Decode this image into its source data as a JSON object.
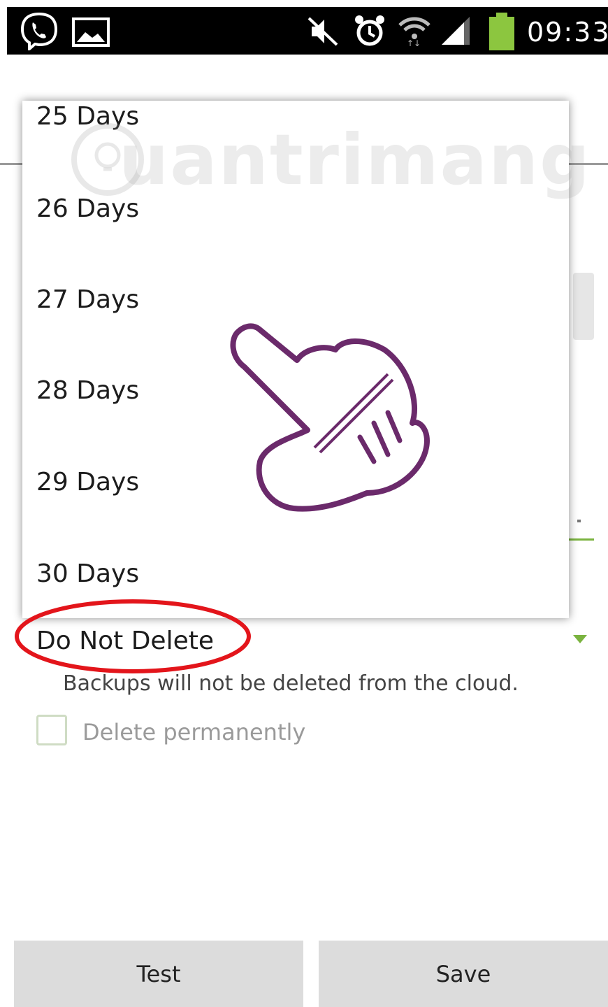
{
  "status_bar": {
    "time": "09:33",
    "icons": [
      "viber-icon",
      "gallery-icon",
      "mute-icon",
      "alarm-icon",
      "wifi-icon",
      "signal-icon",
      "battery-icon"
    ],
    "battery_color": "#8cc63f"
  },
  "popup": {
    "options": [
      "25 Days",
      "26 Days",
      "27 Days",
      "28 Days",
      "29 Days",
      "30 Days"
    ]
  },
  "watermark": "uantrimang",
  "setting": {
    "selected_value": "Do Not Delete",
    "hint": "Backups will not be deleted from the cloud.",
    "checkbox_label": "Delete permanently",
    "checkbox_checked": false,
    "accent_color": "#7ab33f",
    "highlight_color": "#e3151b"
  },
  "buttons": {
    "test": "Test",
    "save": "Save"
  },
  "pointer_color": "#6b2a6b"
}
